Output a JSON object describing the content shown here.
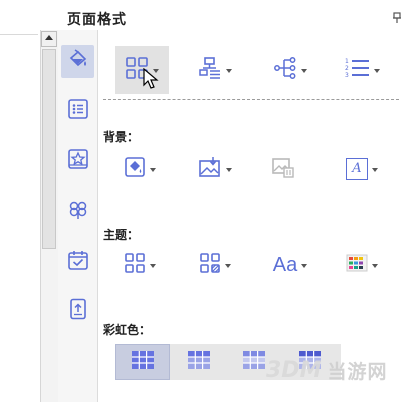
{
  "panel": {
    "title": "页面格式",
    "pin_icon": "pin-icon"
  },
  "colors": {
    "icon_blue": "#5b6fd6",
    "selected_bg": "#cfd6ea",
    "hover_bg": "#e2e2e2",
    "text": "#222222"
  },
  "sidebar": {
    "items": [
      {
        "name": "format-paint",
        "icon": "paint-bucket-icon",
        "selected": true
      },
      {
        "name": "list",
        "icon": "list-icon",
        "selected": false
      },
      {
        "name": "star-frame",
        "icon": "star-frame-icon",
        "selected": false
      },
      {
        "name": "clover",
        "icon": "clover-icon",
        "selected": false
      },
      {
        "name": "calendar-check",
        "icon": "calendar-check-icon",
        "selected": false
      },
      {
        "name": "tablet-upload",
        "icon": "tablet-upload-icon",
        "selected": false
      }
    ]
  },
  "toolbar": {
    "layout_buttons": [
      {
        "icon": "grid-layout-icon",
        "highlighted": true
      },
      {
        "icon": "org-chart-icon",
        "highlighted": false
      },
      {
        "icon": "tree-branch-icon",
        "highlighted": false
      },
      {
        "icon": "numbered-list-icon",
        "highlighted": false
      }
    ]
  },
  "sections": {
    "background": {
      "label": "背景：",
      "buttons": [
        {
          "icon": "fill-color-icon"
        },
        {
          "icon": "insert-image-icon"
        },
        {
          "icon": "image-delete-icon",
          "disabled": true
        },
        {
          "icon": "text-style-icon",
          "glyph": "A"
        }
      ]
    },
    "theme": {
      "label": "主题：",
      "buttons": [
        {
          "icon": "theme-grid-icon"
        },
        {
          "icon": "theme-grid-pattern-icon"
        },
        {
          "icon": "font-theme-icon",
          "glyph": "Aa"
        },
        {
          "icon": "color-theme-icon"
        }
      ]
    },
    "rainbow": {
      "label": "彩虹色：",
      "selected_index": 0,
      "count": 4
    }
  },
  "watermark": {
    "logo": "3DM",
    "text": "当游网"
  }
}
